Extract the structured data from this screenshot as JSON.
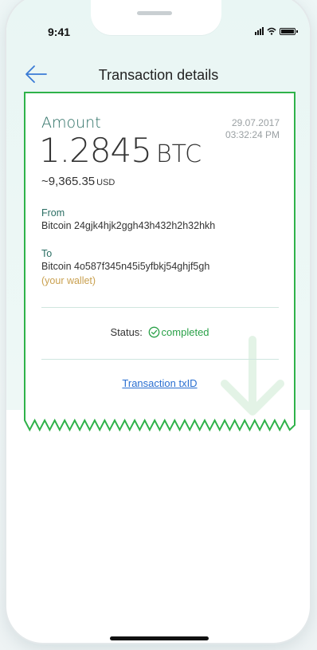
{
  "status_bar": {
    "time": "9:41"
  },
  "header": {
    "title": "Transaction details",
    "back_icon": "arrow-left-icon"
  },
  "transaction": {
    "amount_label": "Amount",
    "amount_value": "1.2845",
    "amount_currency": "BTC",
    "fiat_value": "~9,365.35",
    "fiat_currency": "USD",
    "date": "29.07.2017",
    "time": "03:32:24 PM",
    "from_label": "From",
    "from_address": "Bitcoin 24gjk4hjk2ggh43h432h2h32hkh",
    "to_label": "To",
    "to_address": "Bitcoin 4o587f345n45i5yfbkj54ghjf5gh",
    "to_note": "(your wallet)",
    "status_label": "Status:",
    "status_value": "completed",
    "txid_link": "Transaction txID"
  },
  "colors": {
    "accent_green": "#2aa148",
    "link_blue": "#2a6fd1",
    "wallet_note": "#c9a04f",
    "back_arrow": "#3a7bd5",
    "receipt_border": "#2fb24a"
  }
}
